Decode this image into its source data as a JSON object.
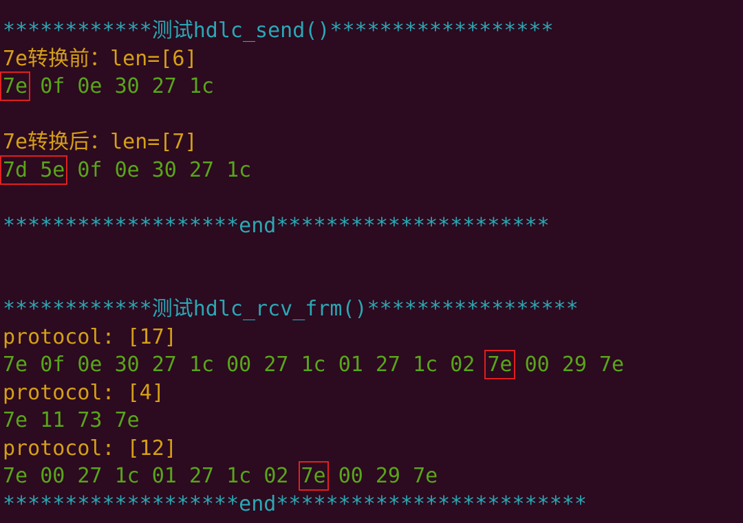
{
  "terminal": {
    "lines": [
      {
        "kind": "cyan",
        "text": "************测试hdlc_send()******************"
      },
      {
        "kind": "yellow",
        "text": "7e转换前：len=[6]"
      },
      {
        "kind": "hex",
        "tokens": [
          "7e",
          "0f",
          "0e",
          "30",
          "27",
          "1c"
        ],
        "highlight": [
          [
            0,
            0
          ]
        ]
      },
      {
        "kind": "blank",
        "text": ""
      },
      {
        "kind": "yellow",
        "text": "7e转换后：len=[7]"
      },
      {
        "kind": "hex",
        "tokens": [
          "7d",
          "5e",
          "0f",
          "0e",
          "30",
          "27",
          "1c"
        ],
        "highlight": [
          [
            0,
            1
          ]
        ]
      },
      {
        "kind": "blank",
        "text": ""
      },
      {
        "kind": "cyan",
        "text": "*******************end**********************"
      },
      {
        "kind": "blank",
        "text": ""
      },
      {
        "kind": "blank",
        "text": ""
      },
      {
        "kind": "cyan",
        "text": "************测试hdlc_rcv_frm()*****************"
      },
      {
        "kind": "yellow",
        "text": "protocol: [17]"
      },
      {
        "kind": "hex",
        "tokens": [
          "7e",
          "0f",
          "0e",
          "30",
          "27",
          "1c",
          "00",
          "27",
          "1c",
          "01",
          "27",
          "1c",
          "02",
          "7e",
          "00",
          "29",
          "7e"
        ],
        "highlight": [
          [
            13,
            13
          ]
        ]
      },
      {
        "kind": "yellow",
        "text": "protocol: [4]"
      },
      {
        "kind": "hex",
        "tokens": [
          "7e",
          "11",
          "73",
          "7e"
        ],
        "highlight": []
      },
      {
        "kind": "yellow",
        "text": "protocol: [12]"
      },
      {
        "kind": "hex",
        "tokens": [
          "7e",
          "00",
          "27",
          "1c",
          "01",
          "27",
          "1c",
          "02",
          "7e",
          "00",
          "29",
          "7e"
        ],
        "highlight": [
          [
            8,
            8
          ]
        ]
      },
      {
        "kind": "cyan",
        "text": "*******************end*************************"
      }
    ]
  },
  "colors": {
    "background": "#2c0a1f",
    "separator": "#2aa8b5",
    "header": "#d4a017",
    "hex": "#58a61a",
    "highlight_box": "#e02020"
  }
}
